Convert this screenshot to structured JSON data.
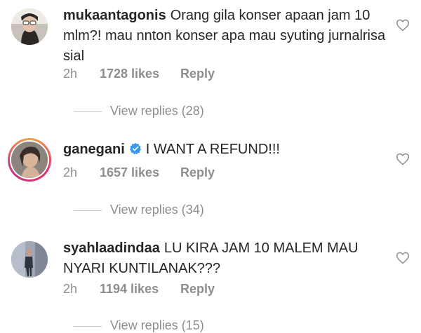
{
  "comments": [
    {
      "username": "mukaantagonis",
      "verified": false,
      "text": "Orang gila konser apaan jam 10 mlm?! mau nnton konser apa mau syuting jurnalrisa sial",
      "time": "2h",
      "likes": "1728 likes",
      "reply_label": "Reply",
      "view_replies": "View replies (28)"
    },
    {
      "username": "ganegani",
      "verified": true,
      "text": "I WANT A REFUND!!!",
      "time": "2h",
      "likes": "1657 likes",
      "reply_label": "Reply",
      "view_replies": "View replies (34)"
    },
    {
      "username": "syahlaadindaa",
      "verified": false,
      "text": "LU KIRA JAM 10 MALEM MAU NYARI KUNTILANAK???",
      "time": "2h",
      "likes": "1194 likes",
      "reply_label": "Reply",
      "view_replies": "View replies (15)"
    }
  ],
  "icons": {
    "like": "heart-outline-icon",
    "verified": "verified-badge-icon"
  },
  "colors": {
    "text": "#262626",
    "secondary": "#8e8e8e",
    "verified": "#3897f0",
    "story_ring": [
      "#f9a23c",
      "#e1306c",
      "#c13584"
    ]
  }
}
